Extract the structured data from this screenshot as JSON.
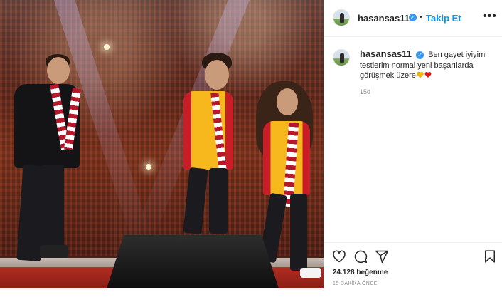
{
  "post": {
    "image_alt": "Concert stage photo",
    "header": {
      "username": "hasansas11",
      "separator": "•",
      "follow_label": "Takip Et",
      "more_icon": "more-options-icon"
    },
    "caption": {
      "username": "hasansas11",
      "text": "Ben gayet iyiyim testlerim normal yeni başarılarda görüşmek üzere",
      "emoji": [
        "yellow-heart",
        "red-heart"
      ],
      "age": "15d"
    },
    "actions": {
      "like_icon": "heart-icon",
      "comment_icon": "comment-icon",
      "share_icon": "share-icon",
      "save_icon": "bookmark-icon"
    },
    "likes": "24.128 beğenme",
    "timestamp": "15 DAKİKA ÖNCE"
  },
  "colors": {
    "link_blue": "#0095f6",
    "verified_blue": "#3897f0",
    "yellow_heart": "#f2b705",
    "red_heart": "#d61a1a",
    "muted": "#8e8e8e"
  }
}
